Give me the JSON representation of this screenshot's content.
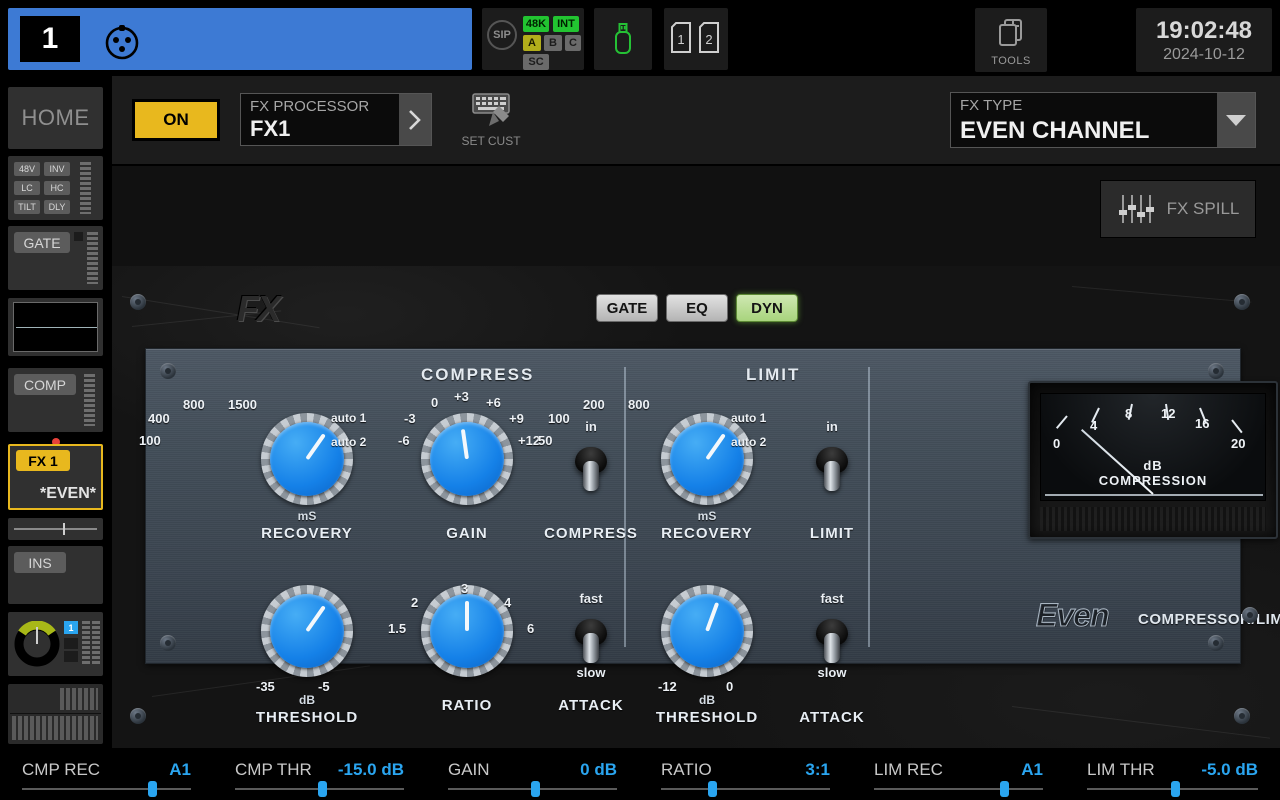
{
  "topbar": {
    "channel_number": "1",
    "channel_icon": "xlr-icon",
    "sip_label": "SIP",
    "status_tags": [
      {
        "text": "48K",
        "style": "green"
      },
      {
        "text": "INT",
        "style": "green"
      },
      {
        "text": "A",
        "style": "yellow"
      },
      {
        "text": "B",
        "style": "grey"
      },
      {
        "text": "C",
        "style": "grey"
      },
      {
        "text": "SC",
        "style": "grey"
      }
    ],
    "usb_icon": "usb-drive-icon",
    "sd_cards": [
      "1",
      "2"
    ],
    "tools_label": "TOOLS",
    "tools_icon": "pages-icon",
    "clock_time": "19:02:48",
    "clock_date": "2024-10-12"
  },
  "sidebar": {
    "home_label": "HOME",
    "preamp_tags": [
      "48V",
      "INV",
      "LC",
      "HC",
      "TILT",
      "DLY"
    ],
    "gate_label": "GATE",
    "comp_label": "COMP",
    "fx_tag": "FX 1",
    "fx_name": "*EVEN*",
    "ins_label": "INS",
    "pan_badge": "1"
  },
  "fx_header": {
    "on_label": "ON",
    "processor_label": "FX PROCESSOR",
    "processor_value": "FX1",
    "next_icon": "chevron-right-icon",
    "setcust_label": "SET CUST",
    "setcust_icon": "keyboard-pen-icon",
    "fxtype_label": "FX TYPE",
    "fxtype_value": "EVEN CHANNEL",
    "dropdown_icon": "chevron-down-icon",
    "spill_label": "FX SPILL",
    "spill_icon": "faders-icon"
  },
  "plugin": {
    "brand": "Even",
    "brand_sub": "COMPRESSOR/LIMITER",
    "panel_logo": "FX",
    "tabs": [
      {
        "label": "GATE",
        "active": false
      },
      {
        "label": "EQ",
        "active": false
      },
      {
        "label": "DYN",
        "active": true
      }
    ],
    "sections": [
      {
        "title": "COMPRESS"
      },
      {
        "title": "LIMIT"
      }
    ],
    "controls": {
      "cmp_recovery": {
        "name": "RECOVERY",
        "unit": "mS",
        "scale": [
          "100",
          "400",
          "800",
          "1500",
          "auto 1",
          "auto 2"
        ],
        "angle": 35
      },
      "cmp_gain": {
        "name": "GAIN",
        "unit": "",
        "scale": [
          "-6",
          "-3",
          "0",
          "+3",
          "+6",
          "+9",
          "+12"
        ],
        "angle": -8
      },
      "cmp_switch": {
        "name": "COMPRESS",
        "top_label": "in",
        "bottom_label": "",
        "state": "down"
      },
      "cmp_threshold": {
        "name": "THRESHOLD",
        "unit": "dB",
        "scale": [
          "-35",
          "-5"
        ],
        "angle": 35
      },
      "cmp_ratio": {
        "name": "RATIO",
        "unit": "",
        "scale": [
          "1.5",
          "2",
          "3",
          "4",
          "6"
        ],
        "angle": 0
      },
      "cmp_attack": {
        "name": "ATTACK",
        "top_label": "fast",
        "bottom_label": "slow",
        "state": "down"
      },
      "lim_recovery": {
        "name": "RECOVERY",
        "unit": "mS",
        "scale": [
          "50",
          "100",
          "200",
          "800",
          "auto 1",
          "auto 2"
        ],
        "angle": 35
      },
      "lim_switch": {
        "name": "LIMIT",
        "top_label": "in",
        "bottom_label": "",
        "state": "down"
      },
      "lim_threshold": {
        "name": "THRESHOLD",
        "unit": "dB",
        "scale": [
          "-12",
          "0"
        ],
        "angle": 20
      },
      "lim_attack": {
        "name": "ATTACK",
        "top_label": "fast",
        "bottom_label": "slow",
        "state": "down"
      }
    },
    "vu_meter": {
      "title_line1": "dB",
      "title_line2": "COMPRESSION",
      "ticks": [
        "0",
        "4",
        "8",
        "12",
        "16",
        "20"
      ],
      "needle_value": 0
    }
  },
  "bottom_strips": [
    {
      "name": "CMP REC",
      "value": "A1",
      "pos": 76
    },
    {
      "name": "CMP THR",
      "value": "-15.0 dB",
      "pos": 50
    },
    {
      "name": "GAIN",
      "value": "0 dB",
      "pos": 50
    },
    {
      "name": "RATIO",
      "value": "3:1",
      "pos": 28
    },
    {
      "name": "LIM REC",
      "value": "A1",
      "pos": 76
    },
    {
      "name": "LIM THR",
      "value": "-5.0 dB",
      "pos": 50
    }
  ],
  "colors": {
    "accent_blue": "#2aa5f0",
    "channel_blue": "#3d7ad4",
    "amber": "#e8b81e",
    "green": "#22c431",
    "knob_blue": "#1581e8"
  }
}
